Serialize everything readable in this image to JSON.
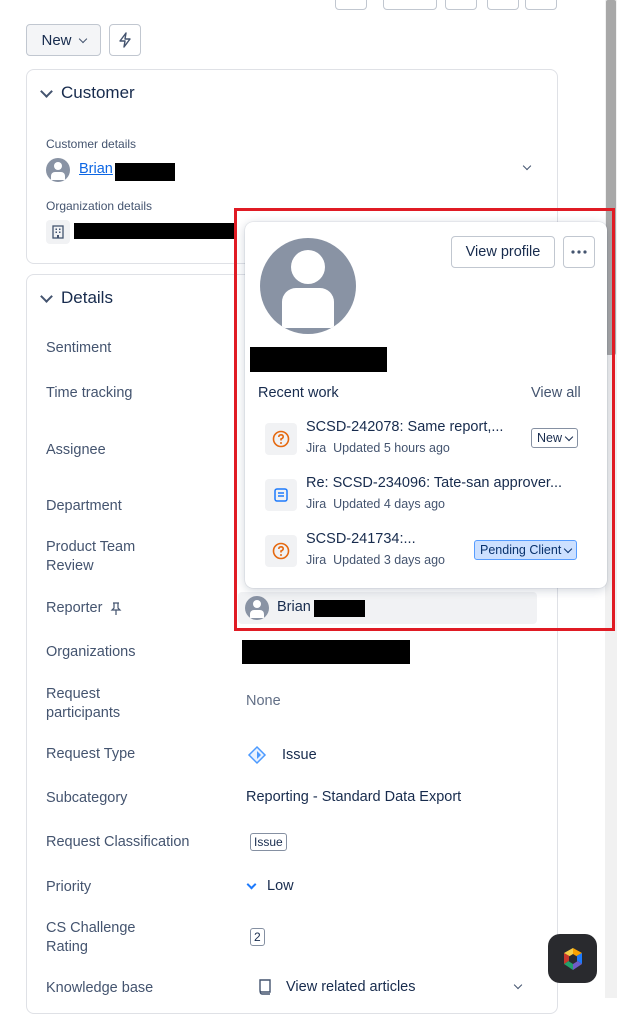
{
  "toolbar": {
    "new_label": "New"
  },
  "customer": {
    "title": "Customer",
    "customer_details_label": "Customer details",
    "customer_name": "Brian",
    "organization_details_label": "Organization details"
  },
  "details": {
    "title": "Details",
    "fields": {
      "sentiment": "Sentiment",
      "time_tracking": "Time tracking",
      "assignee": "Assignee",
      "department": "Department",
      "product_team_review": "Product Team Review",
      "reporter": "Reporter",
      "organizations": "Organizations",
      "request_participants": "Request participants",
      "request_type": "Request Type",
      "subcategory": "Subcategory",
      "request_classification": "Request Classification",
      "priority": "Priority",
      "cs_challenge_rating": "CS Challenge Rating",
      "knowledge_base": "Knowledge base"
    },
    "values": {
      "reporter_name": "Brian",
      "request_participants": "None",
      "request_type": "Issue",
      "subcategory": "Reporting - Standard Data Export",
      "request_classification": "Issue",
      "priority": "Low",
      "cs_challenge_rating": "2",
      "knowledge_base": "View related articles"
    }
  },
  "profile_card": {
    "view_profile": "View profile",
    "recent_work_label": "Recent work",
    "view_all": "View all",
    "items": [
      {
        "title": "SCSD-242078: Same report,...",
        "source": "Jira",
        "updated": "Updated 5 hours ago",
        "status": "New",
        "icon": "question-icon"
      },
      {
        "title": "Re: SCSD-234096: Tate-san approver...",
        "source": "Jira",
        "updated": "Updated 4 days ago",
        "status": "",
        "icon": "document-icon"
      },
      {
        "title": "SCSD-241734:...",
        "source": "Jira",
        "updated": "Updated 3 days ago",
        "status": "Pending Client",
        "icon": "question-icon"
      }
    ]
  },
  "colors": {
    "link": "#0c66e4",
    "highlight_border": "#e01b24",
    "pending_bg": "#cce0ff",
    "avatar": "#8993a4"
  }
}
